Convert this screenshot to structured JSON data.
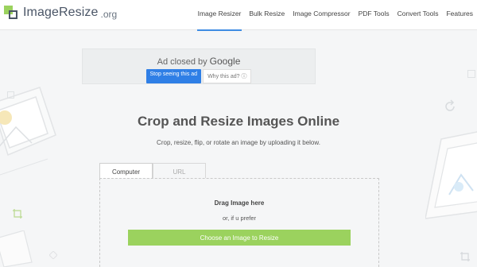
{
  "header": {
    "logo_text": "ImageResize",
    "logo_tld": ".org",
    "nav": [
      {
        "label": "Image Resizer",
        "active": true
      },
      {
        "label": "Bulk Resize"
      },
      {
        "label": "Image Compressor"
      },
      {
        "label": "PDF Tools"
      },
      {
        "label": "Convert Tools"
      },
      {
        "label": "Features"
      }
    ]
  },
  "ad": {
    "closed_text": "Ad closed by",
    "brand": "Google",
    "stop_label": "Stop seeing this ad",
    "why_label": "Why this ad? ⓘ"
  },
  "main": {
    "title": "Crop and Resize Images Online",
    "subtitle": "Crop, resize, flip, or rotate an image by uploading it below.",
    "tabs": [
      {
        "label": "Computer",
        "active": true
      },
      {
        "label": "URL"
      }
    ],
    "drag_text": "Drag Image here",
    "or_text": "or, if u prefer",
    "choose_label": "Choose an Image to Resize"
  },
  "colors": {
    "accent_green": "#9bd25e",
    "link_blue": "#3e8ce3",
    "ad_button_blue": "#2f7fe6"
  }
}
